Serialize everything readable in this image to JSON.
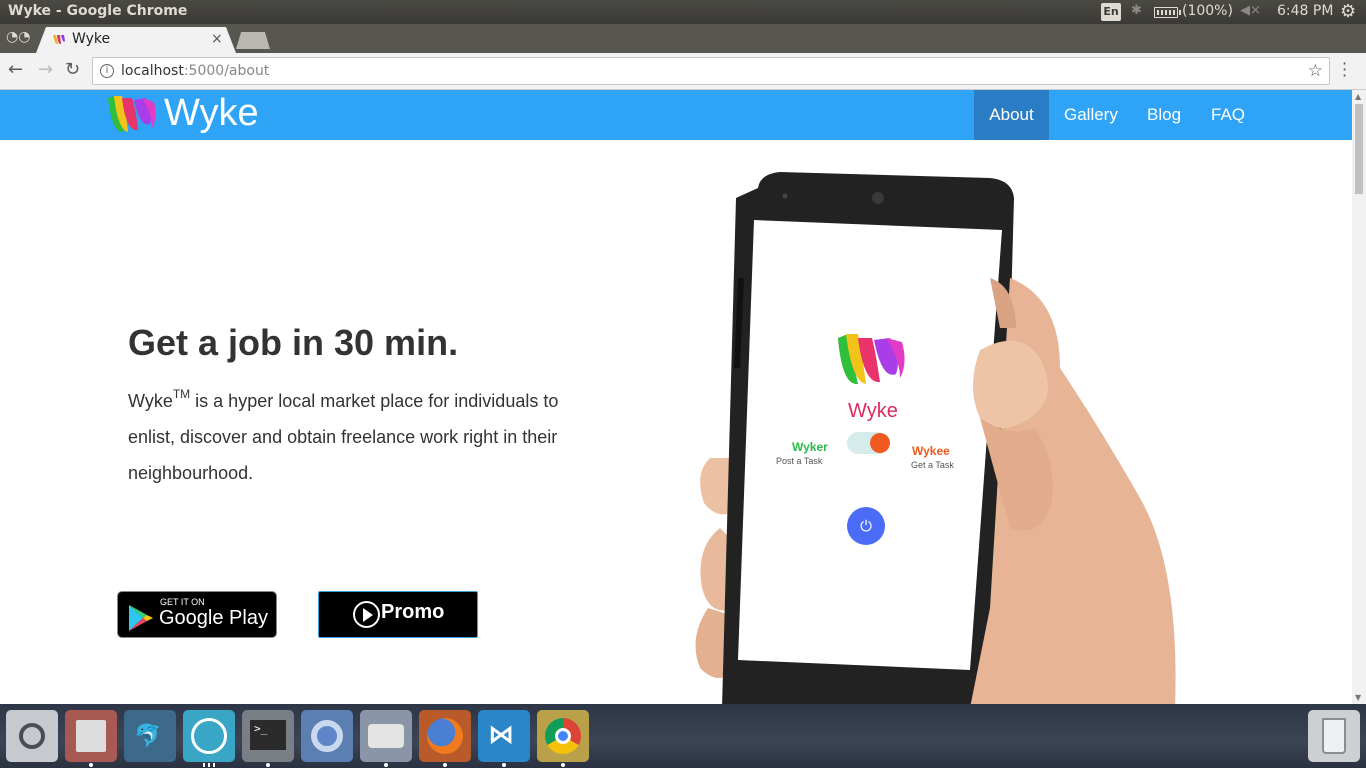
{
  "window": {
    "title": "Wyke - Google Chrome"
  },
  "tray": {
    "keyboard": "En",
    "battery": "(100%)",
    "clock": "6:48 PM"
  },
  "browser": {
    "tab_title": "Wyke",
    "tab_close": "×",
    "url_host": "localhost",
    "url_path": ":5000/about"
  },
  "site": {
    "brand": "Wyke",
    "nav": [
      "About",
      "Gallery",
      "Blog",
      "FAQ"
    ],
    "active_nav": "About",
    "hero": {
      "title": "Get a job in 30 min.",
      "body_prefix": "Wyke",
      "body_sup": "TM",
      "body_text": " is a hyper local market place for individuals to enlist, discover and obtain freelance work right in their neighbourhood."
    },
    "google_play": {
      "small": "GET IT ON",
      "large": "Google Play"
    },
    "promo_label": "Promo",
    "phone_screen": {
      "app_name": "Wyke",
      "wyker_label": "Wyker",
      "wyker_sub": "Post a Task",
      "wykee_label": "Wykee",
      "wykee_sub": "Get a Task"
    }
  },
  "colors": {
    "nav_bg": "#2fa3f5",
    "nav_active": "#2a7cc4",
    "wyker_green": "#2db84a",
    "wykee_orange": "#f05a1e",
    "power_blue": "#4a6cf7"
  },
  "launcher": [
    "ubuntu-dash-icon",
    "files-icon",
    "mysql-workbench-icon",
    "paw-icon",
    "terminal-icon",
    "chromium-icon",
    "disk-icon",
    "firefox-icon",
    "vscode-icon",
    "chrome-icon"
  ]
}
